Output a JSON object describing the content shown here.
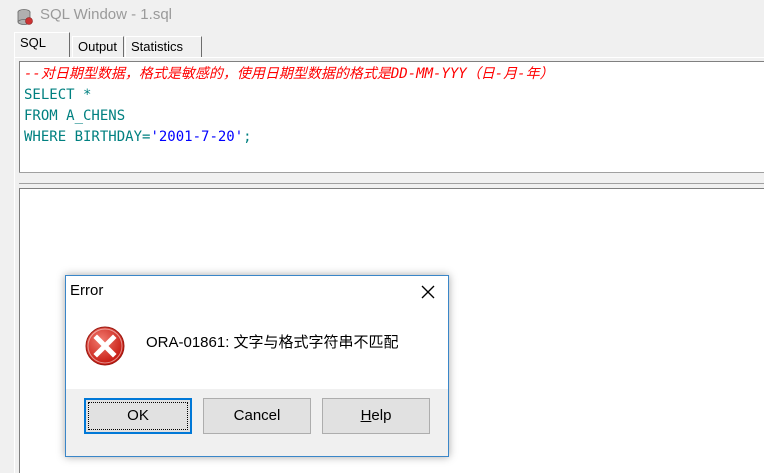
{
  "window": {
    "title": "SQL Window - 1.sql"
  },
  "tabs": [
    {
      "label": "SQL",
      "active": true
    },
    {
      "label": "Output",
      "active": false
    },
    {
      "label": "Statistics",
      "active": false
    }
  ],
  "editor": {
    "lines": [
      {
        "kind": "comment",
        "text": "--对日期型数据，格式是敏感的，使用日期型数据的格式是DD-MM-YYY（日-月-年）"
      },
      {
        "kind": "code",
        "text": "SELECT *"
      },
      {
        "kind": "code",
        "text": "FROM A_CHENS"
      },
      {
        "kind": "code_string",
        "before": "WHERE BIRTHDAY=",
        "string": "'2001-7-20'",
        "after": ";"
      }
    ]
  },
  "dialog": {
    "title": "Error",
    "message": "ORA-01861: 文字与格式字符串不匹配",
    "buttons": {
      "ok": "OK",
      "cancel": "Cancel",
      "help_prefix": "",
      "help_underlined": "H",
      "help_rest": "elp"
    }
  },
  "colors": {
    "comment": "#ff0000",
    "keyword": "#008080",
    "string": "#0000ff",
    "dialog_border": "#3a86c8",
    "focus_button_border": "#0078d7",
    "error_icon": "#d9261c"
  },
  "icons": {
    "app": "database-icon",
    "close": "close-icon",
    "error": "error-icon"
  }
}
